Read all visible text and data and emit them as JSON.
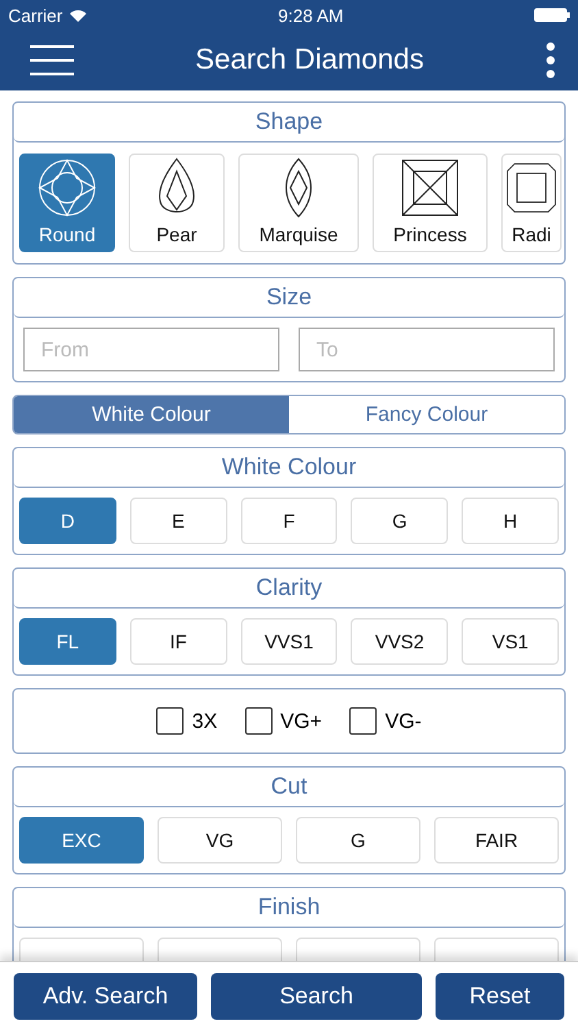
{
  "status_bar": {
    "carrier": "Carrier",
    "time": "9:28 AM"
  },
  "nav": {
    "title": "Search Diamonds"
  },
  "shape": {
    "title": "Shape",
    "items": [
      {
        "label": "Round",
        "kind": "round",
        "selected": true
      },
      {
        "label": "Pear",
        "kind": "pear",
        "selected": false
      },
      {
        "label": "Marquise",
        "kind": "marquise",
        "selected": false
      },
      {
        "label": "Princess",
        "kind": "princess",
        "selected": false
      },
      {
        "label": "Radi",
        "kind": "radiant",
        "selected": false
      }
    ]
  },
  "size": {
    "title": "Size",
    "from_placeholder": "From",
    "to_placeholder": "To"
  },
  "colour_tabs": [
    {
      "label": "White Colour",
      "selected": true
    },
    {
      "label": "Fancy Colour",
      "selected": false
    }
  ],
  "white_colour": {
    "title": "White Colour",
    "options": [
      {
        "label": "D",
        "selected": true
      },
      {
        "label": "E",
        "selected": false
      },
      {
        "label": "F",
        "selected": false
      },
      {
        "label": "G",
        "selected": false
      },
      {
        "label": "H",
        "selected": false
      }
    ]
  },
  "clarity": {
    "title": "Clarity",
    "options": [
      {
        "label": "FL",
        "selected": true
      },
      {
        "label": "IF",
        "selected": false
      },
      {
        "label": "VVS1",
        "selected": false
      },
      {
        "label": "VVS2",
        "selected": false
      },
      {
        "label": "VS1",
        "selected": false
      }
    ]
  },
  "quick": [
    {
      "label": "3X",
      "checked": false
    },
    {
      "label": "VG+",
      "checked": false
    },
    {
      "label": "VG-",
      "checked": false
    }
  ],
  "cut": {
    "title": "Cut",
    "options": [
      {
        "label": "EXC",
        "selected": true
      },
      {
        "label": "VG",
        "selected": false
      },
      {
        "label": "G",
        "selected": false
      },
      {
        "label": "FAIR",
        "selected": false
      }
    ]
  },
  "finish": {
    "title": "Finish",
    "options": [
      {
        "selected": false
      },
      {
        "selected": false
      },
      {
        "selected": false
      },
      {
        "selected": false
      }
    ]
  },
  "buttons": [
    "Adv. Search",
    "Search",
    "Reset"
  ]
}
